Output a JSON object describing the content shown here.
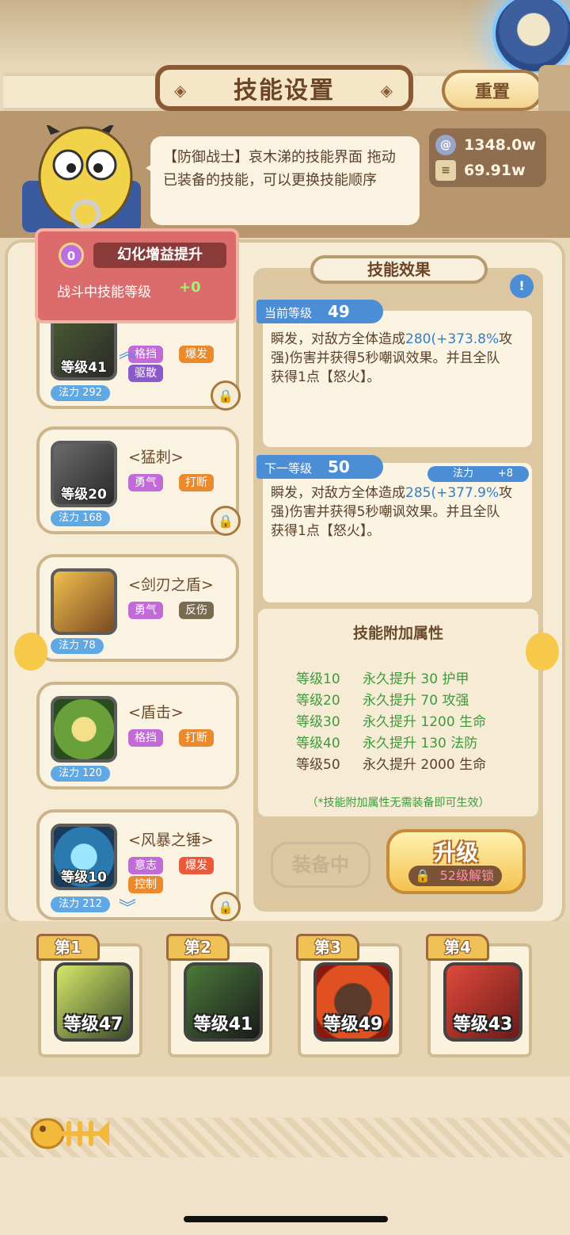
{
  "header": {
    "title": "技能设置",
    "reset_label": "重置",
    "side_tab_icon": "chevron-left-icon"
  },
  "speech": {
    "text": "【防御战士】哀木涕的技能界面 拖动已装备的技能，可以更换技能顺序"
  },
  "resources": [
    {
      "icon": "spiral-coin-icon",
      "value": "1348.0w"
    },
    {
      "icon": "scroll-icon",
      "value": "69.91w"
    }
  ],
  "buff": {
    "badge": "0",
    "title": "幻化增益提升",
    "subtitle": "战斗中技能等级",
    "value": "+0"
  },
  "skills": [
    {
      "name": "",
      "level": "等级41",
      "tags": [
        "格挡",
        "爆发",
        "驱散"
      ],
      "mana": "法力 292"
    },
    {
      "name": "<猛刺>",
      "level": "等级20",
      "tags": [
        "勇气",
        "打断"
      ],
      "mana": "法力 168"
    },
    {
      "name": "<剑刃之盾>",
      "level": "",
      "tags": [
        "勇气",
        "反伤"
      ],
      "mana": "法力 78"
    },
    {
      "name": "<盾击>",
      "level": "",
      "tags": [
        "格挡",
        "打断"
      ],
      "mana": "法力 120"
    },
    {
      "name": "<风暴之锤>",
      "level": "等级10",
      "tags": [
        "意志",
        "爆发",
        "控制"
      ],
      "mana": "法力 212"
    }
  ],
  "effect": {
    "title": "技能效果",
    "current": {
      "label": "当前等级",
      "level": "49",
      "line1_a": "瞬发，对敌方全体造成",
      "line1_b": "280",
      "line1_c": "(+373.8%",
      "line1_d": "攻",
      "line2": "强)伤害并获得5秒嘲讽效果。并且全队",
      "line3": "获得1点【怒火】。"
    },
    "next": {
      "label": "下一等级",
      "level": "50",
      "mana_label": "法力",
      "mana_plus": "+8",
      "line1_a": "瞬发，对敌方全体造成",
      "line1_b": "285",
      "line1_c": "(+377.9%",
      "line1_d": "攻",
      "line2": "强)伤害并获得5秒嘲讽效果。并且全队",
      "line3": "获得1点【怒火】。"
    }
  },
  "attributes": {
    "title": "技能附加属性",
    "rows": [
      {
        "level": "等级10",
        "text": "永久提升 30 护甲"
      },
      {
        "level": "等级20",
        "text": "永久提升 70 攻强"
      },
      {
        "level": "等级30",
        "text": "永久提升 1200 生命"
      },
      {
        "level": "等级40",
        "text": "永久提升 130 法防"
      },
      {
        "level": "等级50",
        "text": "永久提升 2000 生命"
      }
    ],
    "note": "（*技能附加属性无需装备即可生效）"
  },
  "buttons": {
    "equipped": "装备中",
    "upgrade": "升级",
    "unlock": "52级解锁"
  },
  "slots": [
    {
      "label": "第1",
      "level": "等级47"
    },
    {
      "label": "第2",
      "level": "等级41"
    },
    {
      "label": "第3",
      "level": "等级49"
    },
    {
      "label": "第4",
      "level": "等级43"
    }
  ]
}
